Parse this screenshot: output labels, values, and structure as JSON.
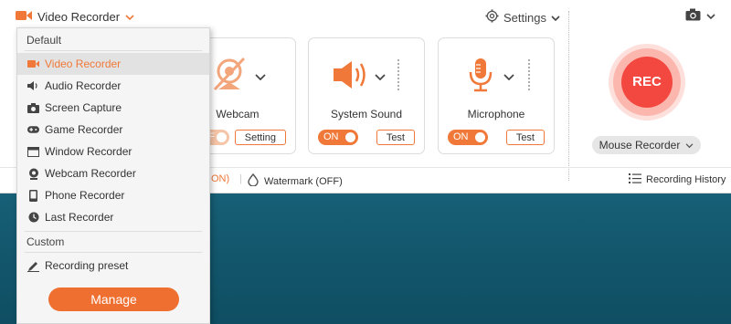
{
  "header": {
    "mode_title": "Video Recorder",
    "settings_label": "Settings"
  },
  "cards": {
    "webcam": {
      "label": "Webcam",
      "toggle": "OFF",
      "button": "Setting"
    },
    "system_sound": {
      "label": "System Sound",
      "toggle": "ON",
      "button": "Test"
    },
    "microphone": {
      "label": "Microphone",
      "toggle": "ON",
      "button": "Test"
    }
  },
  "rec": {
    "label": "REC",
    "mouse_recorder": "Mouse Recorder"
  },
  "bottom": {
    "partial_status": "ON)",
    "watermark": "Watermark (OFF)",
    "recording_history": "Recording History"
  },
  "menu": {
    "default_header": "Default",
    "items": [
      {
        "label": "Video Recorder",
        "icon": "video-camera-icon",
        "selected": true
      },
      {
        "label": "Audio Recorder",
        "icon": "speaker-icon"
      },
      {
        "label": "Screen Capture",
        "icon": "camera-icon"
      },
      {
        "label": "Game Recorder",
        "icon": "gamepad-icon"
      },
      {
        "label": "Window Recorder",
        "icon": "window-icon"
      },
      {
        "label": "Webcam Recorder",
        "icon": "webcam-icon"
      },
      {
        "label": "Phone Recorder",
        "icon": "phone-icon"
      },
      {
        "label": "Last Recorder",
        "icon": "clock-icon"
      }
    ],
    "custom_header": "Custom",
    "preset_label": "Recording preset",
    "manage_label": "Manage"
  },
  "colors": {
    "accent": "#F07838",
    "rec": "#F2483F",
    "menu_bg": "#F5F5F5"
  }
}
